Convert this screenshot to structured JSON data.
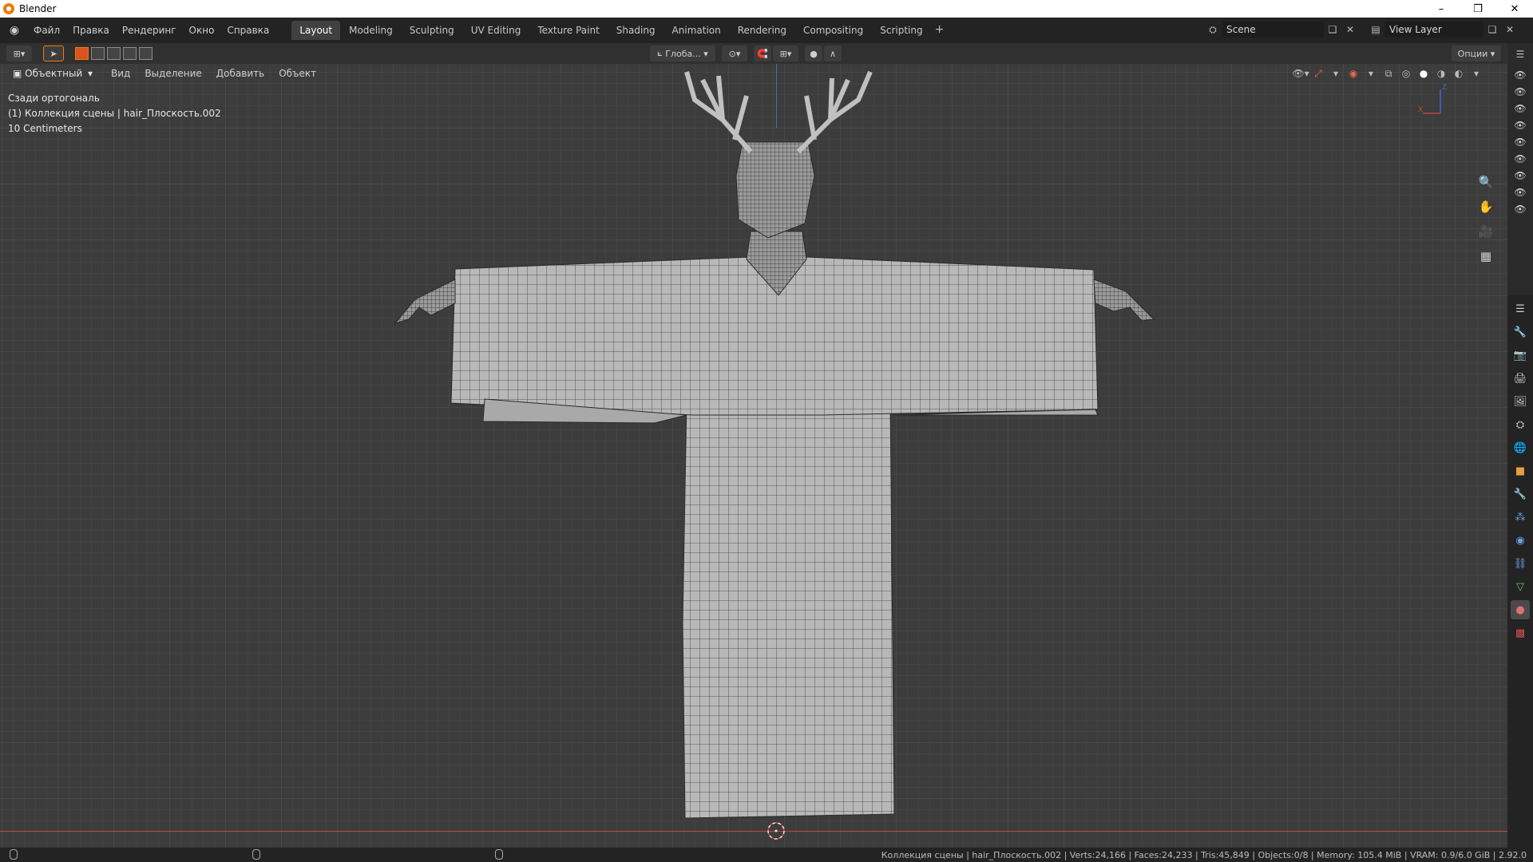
{
  "window": {
    "title": "Blender",
    "controls": [
      "–",
      "❐",
      "✕"
    ]
  },
  "menu": [
    "Файл",
    "Правка",
    "Рендеринг",
    "Окно",
    "Справка"
  ],
  "workspaces": [
    "Layout",
    "Modeling",
    "Sculpting",
    "UV Editing",
    "Texture Paint",
    "Shading",
    "Animation",
    "Rendering",
    "Compositing",
    "Scripting"
  ],
  "active_workspace": "Layout",
  "scene": {
    "name": "Scene"
  },
  "view_layer": {
    "name": "View Layer"
  },
  "toolheader": {
    "transform_orientation": "Глоба...",
    "options_label": "Опции"
  },
  "viewport": {
    "mode": "Объектный",
    "menu": [
      "Вид",
      "Выделение",
      "Добавить",
      "Объект"
    ],
    "view_name": "Сзади ортогональ",
    "collection_line": "(1) Коллекция сцены | hair_Плоскость.002",
    "scale_line": "10 Centimeters"
  },
  "gizmo": {
    "z_label": "Z",
    "x_label": "X"
  },
  "statusbar": {
    "stats": "Коллекция сцены | hair_Плоскость.002 | Verts:24,166 | Faces:24,233 | Tris:45,849 | Objects:0/8 | Memory: 105.4 MiB | VRAM: 0.9/6.0 GiB | 2.92.0"
  },
  "colors": {
    "accent_orange": "#e87d0d",
    "active_blue": "#4772b3",
    "axis_x": "#b34a4a",
    "axis_y": "#4a6fb3"
  },
  "icons": {
    "nav": [
      "zoom-icon",
      "hand-pan-icon",
      "camera-icon",
      "grid-icon"
    ],
    "props": [
      "tool-icon",
      "render-icon",
      "output-icon",
      "view-layer-icon",
      "scene-icon",
      "world-icon",
      "object-icon",
      "modifier-icon",
      "particles-icon",
      "physics-icon",
      "constraints-icon",
      "data-icon",
      "material-icon",
      "texture-icon"
    ]
  }
}
